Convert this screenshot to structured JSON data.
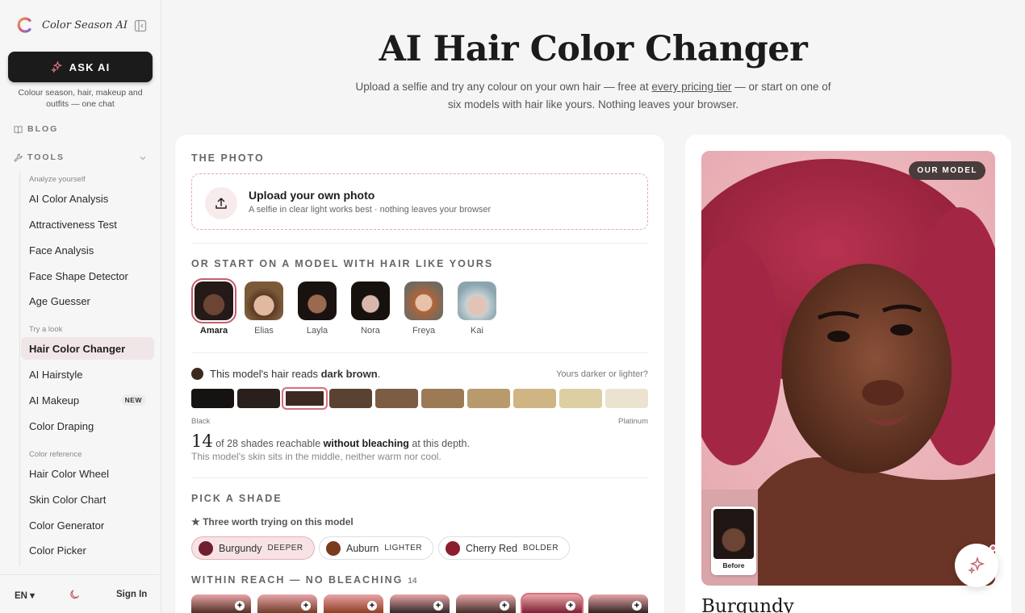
{
  "sidebar": {
    "brand": "Color Season AI",
    "ask_label": "ASK AI",
    "ask_sub": "Colour season, hair, makeup and outfits — one chat",
    "blog": "BLOG",
    "tools": "TOOLS",
    "groups": {
      "analyze": "Analyze yourself",
      "try": "Try a look",
      "reference": "Color reference"
    },
    "items": {
      "ai_color_analysis": "AI Color Analysis",
      "attractiveness": "Attractiveness Test",
      "face_analysis": "Face Analysis",
      "face_shape": "Face Shape Detector",
      "age_guesser": "Age Guesser",
      "hair_color_changer": "Hair Color Changer",
      "ai_hairstyle": "AI Hairstyle",
      "ai_makeup": "AI Makeup",
      "makeup_badge": "NEW",
      "color_draping": "Color Draping",
      "hair_color_wheel": "Hair Color Wheel",
      "skin_color_chart": "Skin Color Chart",
      "color_generator": "Color Generator",
      "color_picker": "Color Picker"
    },
    "footer": {
      "lang": "EN ▾",
      "signin": "Sign In"
    }
  },
  "header": {
    "title": "AI Hair Color Changer",
    "sub_a": "Upload a selfie and try any colour on your own hair — free at ",
    "sub_link": "every pricing tier",
    "sub_b": " — or start on one of six models with hair like yours. Nothing leaves your browser."
  },
  "card": {
    "photo_label": "THE PHOTO",
    "upload_title": "Upload your own photo",
    "upload_sub": "A selfie in clear light works best · nothing leaves your browser",
    "models_label": "OR START ON A MODEL WITH HAIR LIKE YOURS",
    "models": [
      "Amara",
      "Elias",
      "Layla",
      "Nora",
      "Freya",
      "Kai"
    ],
    "reads_a": "This model's hair reads ",
    "reads_b": "dark brown",
    "reads_c": ".",
    "darker": "Yours darker or lighter?",
    "scale_left": "Black",
    "scale_right": "Platinum",
    "stat_num": "14",
    "stat_a": " of 28 shades reachable ",
    "stat_b": "without bleaching",
    "stat_c": " at this depth.",
    "stat2": "This model's skin sits in the middle, neither warm nor cool.",
    "pick_label": "PICK A SHADE",
    "three": "★ Three worth trying on this model",
    "chips": [
      {
        "name": "Burgundy",
        "tag": "DEEPER"
      },
      {
        "name": "Auburn",
        "tag": "LIGHTER"
      },
      {
        "name": "Cherry Red",
        "tag": "BOLDER"
      }
    ],
    "reach_label": "WITHIN REACH — NO BLEACHING",
    "reach_count": "14"
  },
  "preview": {
    "badge": "OUR MODEL",
    "before": "Before",
    "shade": "Burgundy"
  },
  "colors": {
    "accent": "#c65c6b",
    "swatches": [
      "#151312",
      "#2a1f1a",
      "#3c2a20",
      "#5a4232",
      "#7d5c44",
      "#9d7a56",
      "#b89a6c",
      "#cfb584",
      "#ddcfa3",
      "#ebe3d0"
    ],
    "chip_dots": [
      "#6e1f30",
      "#7a3a1c",
      "#8c1d2f"
    ]
  }
}
